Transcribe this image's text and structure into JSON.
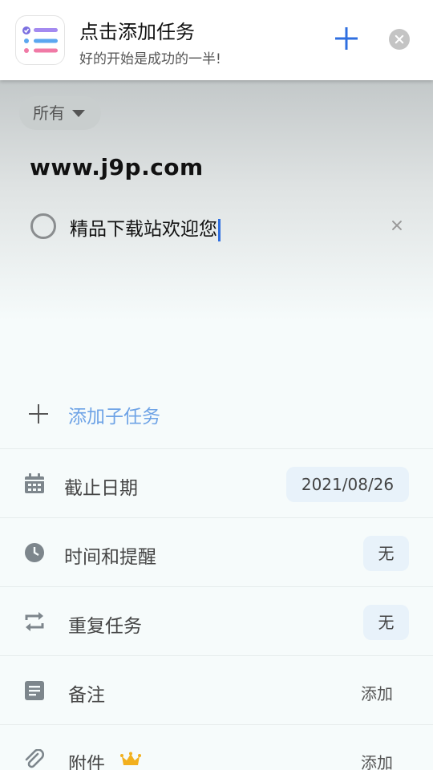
{
  "banner": {
    "title": "点击添加任务",
    "subtitle": "好的开始是成功的一半!",
    "icon": "task-list-icon",
    "add_icon": "plus-icon",
    "close_icon": "close-circle-icon"
  },
  "filter": {
    "label": "所有",
    "icon": "caret-down-icon"
  },
  "list": {
    "name": "www.j9p.com"
  },
  "task": {
    "title": "精品下载站欢迎您",
    "clear_icon": "clear-icon"
  },
  "subtask": {
    "label": "添加子任务",
    "icon": "plus-icon"
  },
  "options": {
    "due_date": {
      "label": "截止日期",
      "value": "2021/08/26",
      "icon": "calendar-icon"
    },
    "reminder": {
      "label": "时间和提醒",
      "value": "无",
      "icon": "clock-icon"
    },
    "repeat": {
      "label": "重复任务",
      "value": "无",
      "icon": "repeat-icon"
    },
    "notes": {
      "label": "备注",
      "action": "添加",
      "icon": "note-icon"
    },
    "attachment": {
      "label": "附件",
      "action": "添加",
      "icon": "paperclip-icon",
      "badge_icon": "crown-icon"
    }
  },
  "colors": {
    "accent": "#2f6fe0",
    "subtask_text": "#6ea3e6",
    "chip_bg": "#e8f2fa",
    "crown": "#f2b01e"
  }
}
